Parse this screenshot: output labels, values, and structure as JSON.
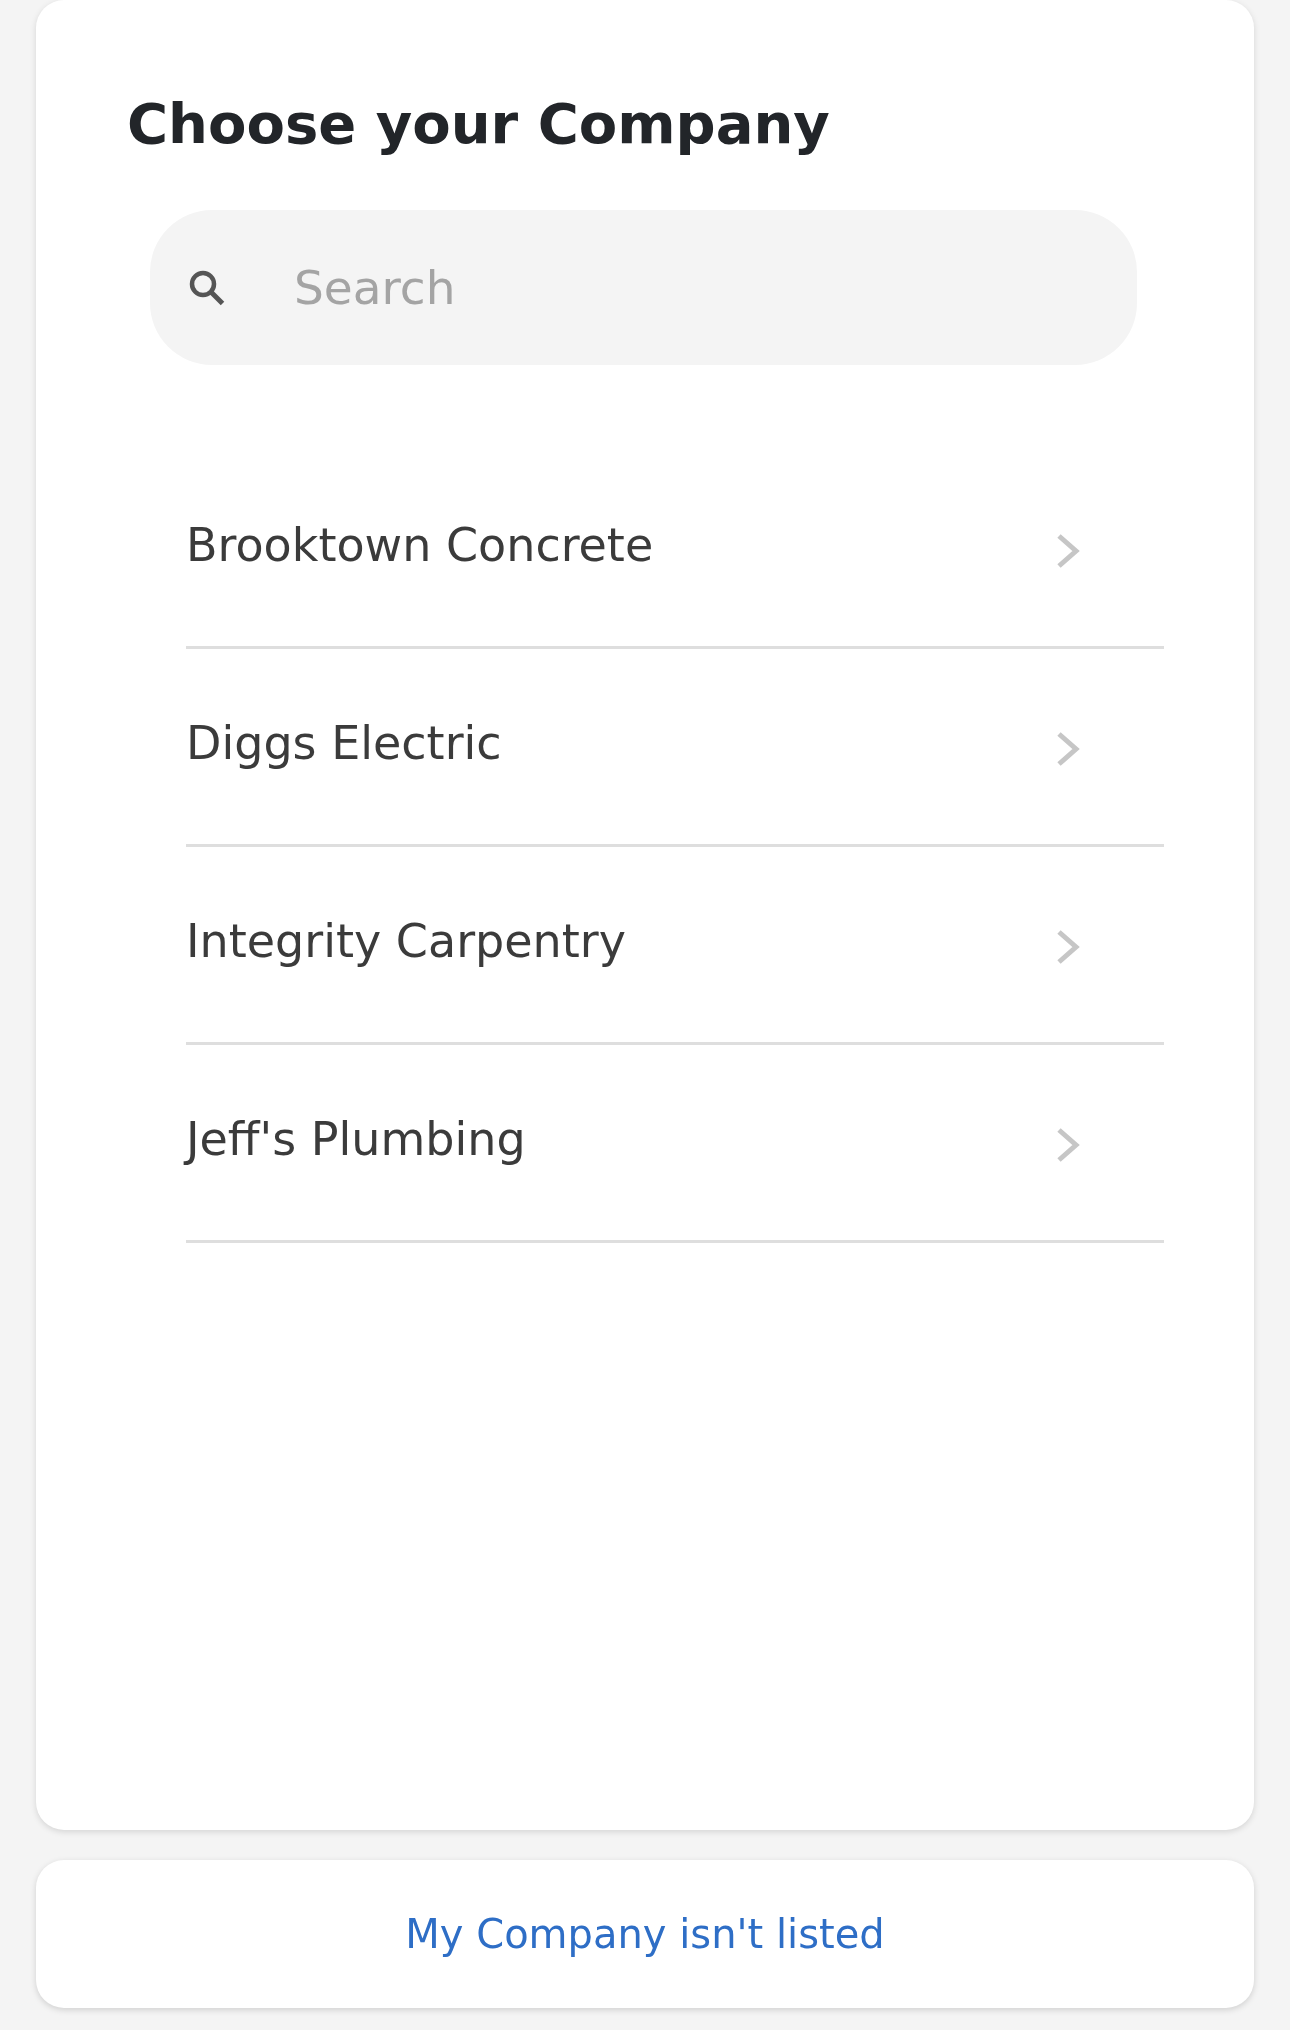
{
  "title": "Choose your Company",
  "search": {
    "placeholder": "Search"
  },
  "companies": [
    {
      "name": "Brooktown Concrete"
    },
    {
      "name": "Diggs Electric"
    },
    {
      "name": "Integrity Carpentry"
    },
    {
      "name": "Jeff's Plumbing"
    }
  ],
  "unlisted_button": {
    "label": "My Company isn't listed"
  }
}
